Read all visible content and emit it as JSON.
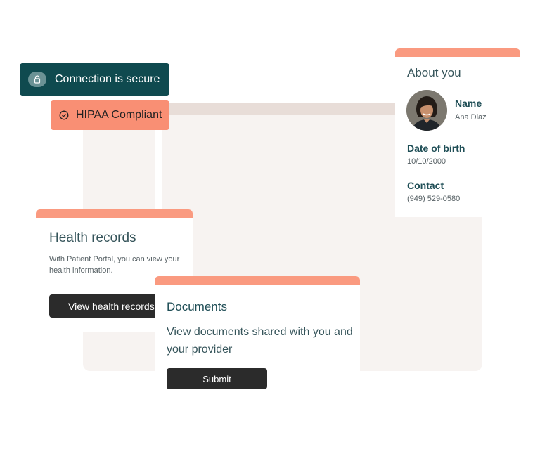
{
  "badges": {
    "secure": {
      "label": "Connection is secure",
      "icon": "lock-icon",
      "color": "#0f4a4f"
    },
    "hipaa": {
      "label": "HIPAA Compliant",
      "icon": "check-circle-icon",
      "color": "#f98f74"
    }
  },
  "about": {
    "title": "About you",
    "avatar_icon": "user-avatar",
    "name_label": "Name",
    "name_value": "Ana Diaz",
    "dob_label": "Date of birth",
    "dob_value": "10/10/2000",
    "contact_label": "Contact",
    "contact_value": "(949) 529-0580"
  },
  "health": {
    "title": "Health records",
    "description": "With Patient Portal, you can view your health information.",
    "button_label": "View health records"
  },
  "documents": {
    "title": "Documents",
    "description": "View documents shared with you and your provider",
    "button_label": "Submit"
  },
  "colors": {
    "accent": "#fa9a80",
    "dark_teal": "#0f4a4f",
    "button_dark": "#2b2b2b",
    "panel_bg": "#f7f3f1"
  }
}
